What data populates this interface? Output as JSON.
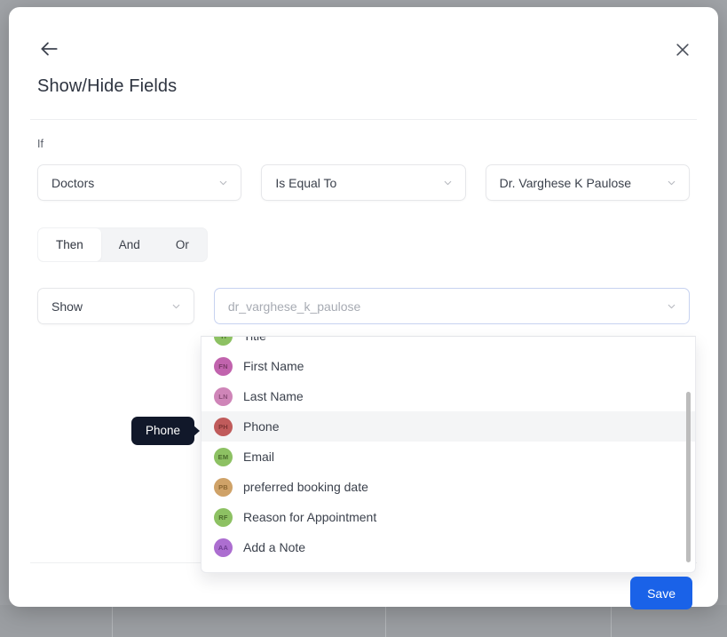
{
  "modal": {
    "title": "Show/Hide Fields",
    "back_icon": "arrow-left-icon",
    "close_icon": "close-icon"
  },
  "condition": {
    "if_label": "If",
    "field_select": "Doctors",
    "operator_select": "Is Equal To",
    "value_select": "Dr. Varghese K Paulose"
  },
  "tabs": [
    {
      "label": "Then",
      "active": true
    },
    {
      "label": "And",
      "active": false
    },
    {
      "label": "Or",
      "active": false
    }
  ],
  "action": {
    "action_select": "Show",
    "multiselect_placeholder": "dr_varghese_k_paulose",
    "multiselect_value": ""
  },
  "dropdown": {
    "items": [
      {
        "initials": "TI",
        "label": "Title",
        "bg": "#8dc163",
        "fg": "#4a6b2c",
        "highlighted": false
      },
      {
        "initials": "FN",
        "label": "First Name",
        "bg": "#c163ad",
        "fg": "#7a3a68",
        "highlighted": false
      },
      {
        "initials": "LN",
        "label": "Last Name",
        "bg": "#cf85b8",
        "fg": "#8c4e79",
        "highlighted": false
      },
      {
        "initials": "PH",
        "label": "Phone",
        "bg": "#c05b5b",
        "fg": "#7d3434",
        "highlighted": true
      },
      {
        "initials": "EM",
        "label": "Email",
        "bg": "#8dc163",
        "fg": "#4a6b2c",
        "highlighted": false
      },
      {
        "initials": "PB",
        "label": "preferred booking date",
        "bg": "#cfa268",
        "fg": "#8a6632",
        "highlighted": false
      },
      {
        "initials": "RF",
        "label": "Reason for Appointment",
        "bg": "#8dc163",
        "fg": "#4a6b2c",
        "highlighted": false
      },
      {
        "initials": "AA",
        "label": "Add a Note",
        "bg": "#ac6ed0",
        "fg": "#6f3c92",
        "highlighted": false
      }
    ]
  },
  "tooltip": {
    "text": "Phone"
  },
  "footer": {
    "save_label": "Save",
    "save_color": "#1a62e8"
  }
}
